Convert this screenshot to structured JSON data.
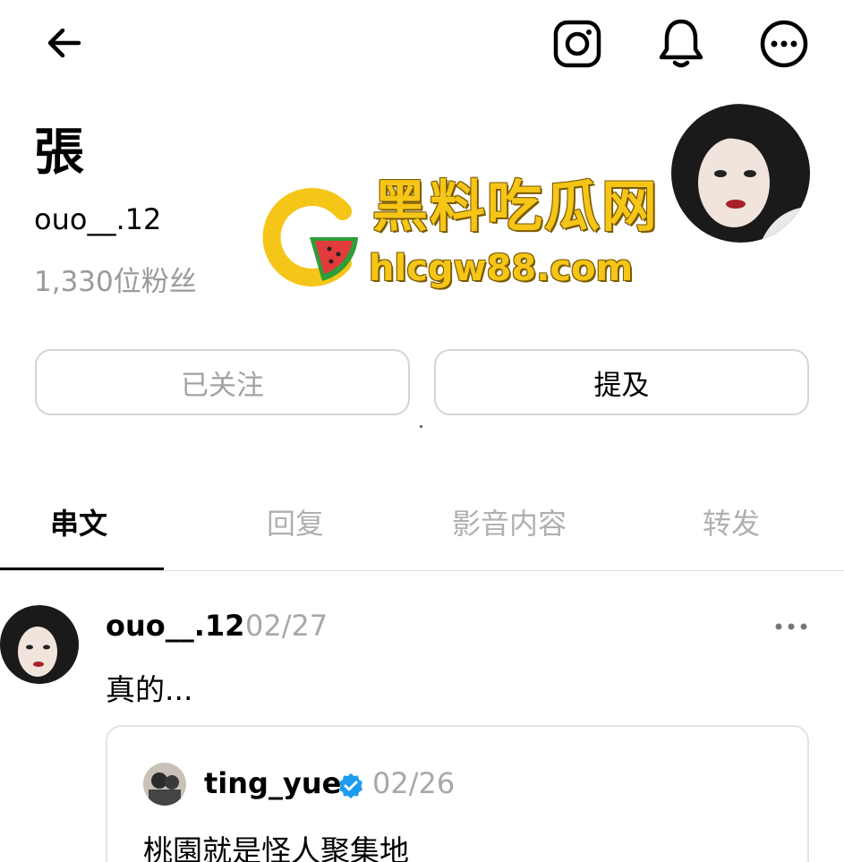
{
  "header": {
    "back_icon": "arrow-left-icon",
    "instagram_icon": "instagram-icon",
    "notification_icon": "bell-icon",
    "more_icon": "more-horizontal-icon"
  },
  "profile": {
    "display_name": "張",
    "username": "ouo__.12",
    "followers": "1,330位粉丝"
  },
  "watermark": {
    "title": "黑料吃瓜网",
    "url": "hlcgw88.com",
    "color": "#f5c518"
  },
  "actions": {
    "followed_label": "已关注",
    "mention_label": "提及"
  },
  "tabs": [
    {
      "label": "串文",
      "active": true
    },
    {
      "label": "回复",
      "active": false
    },
    {
      "label": "影音内容",
      "active": false
    },
    {
      "label": "转发",
      "active": false
    }
  ],
  "post": {
    "username": "ouo__.12",
    "date": "02/27",
    "text": "真的...",
    "quote": {
      "username": "ting_yue",
      "verified": true,
      "date": "02/26",
      "text": "桃園就是怪人聚集地"
    }
  },
  "colors": {
    "verified_blue": "#1d9bf0",
    "muted_text": "#a8a8a8"
  }
}
